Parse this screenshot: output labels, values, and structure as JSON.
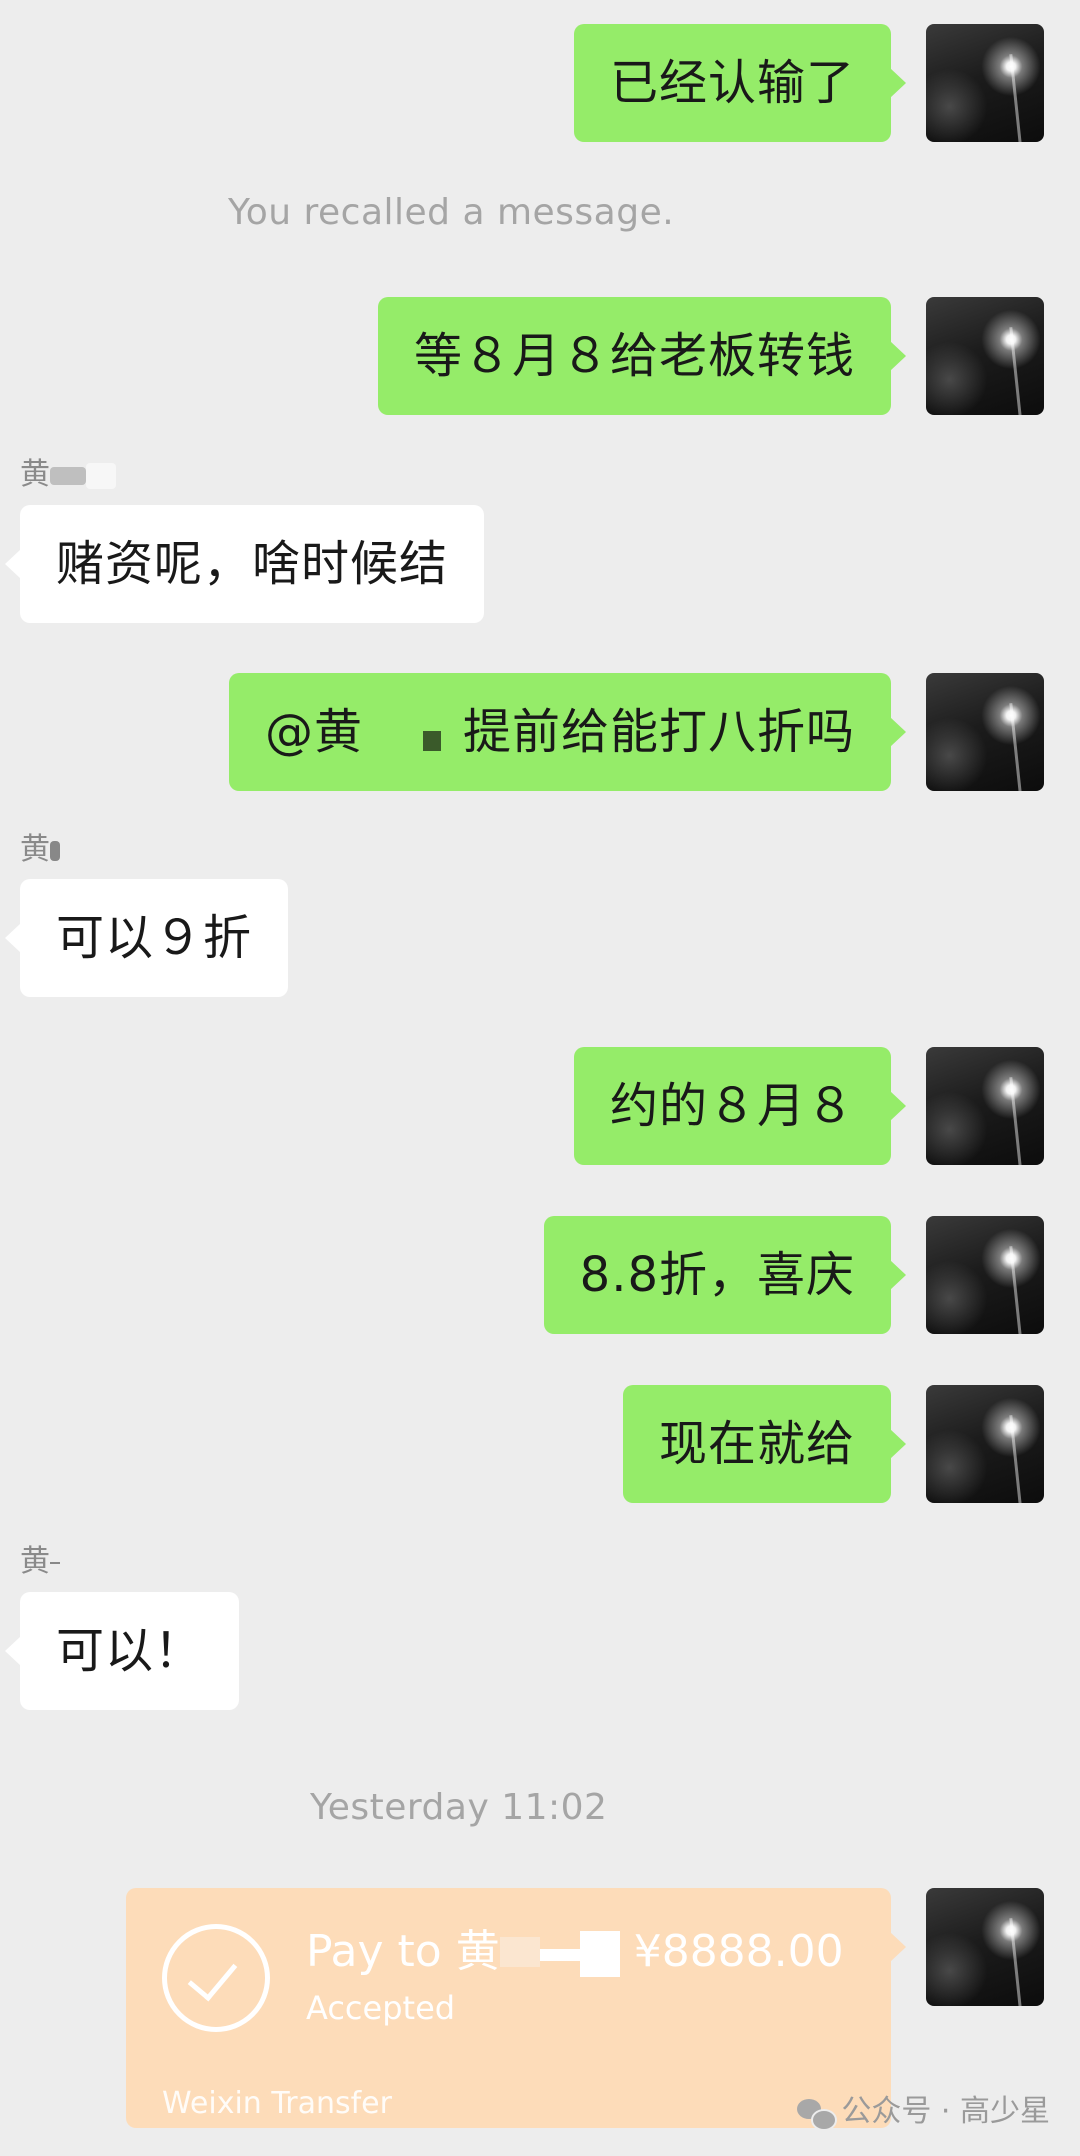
{
  "messages": {
    "m1": "已经认输了",
    "recalled": "You recalled a message.",
    "m2": "等８月８给老板转钱",
    "sender": "黄",
    "m3": "赌资呢，啥时候结",
    "m4_mention": "@黄",
    "m4_rest": "提前给能打八折吗",
    "m5": "可以９折",
    "m6": "约的８月８",
    "m7": "8.8折，喜庆",
    "m8": "现在就给",
    "m9": "可以！",
    "timestamp": "Yesterday 11:02"
  },
  "transfer": {
    "prefix": "Pay to 黄",
    "amount": "¥8888.00",
    "status": "Accepted",
    "footer": "Weixin Transfer",
    "color": "#fddcb9"
  },
  "watermark": "公众号 · 高少星",
  "colors": {
    "background": "#ededed",
    "my_bubble": "#95ec69",
    "their_bubble": "#ffffff"
  },
  "icons": {
    "avatar": "night-street-lamp-photo",
    "transfer": "check-circle-icon",
    "watermark": "wechat-icon"
  }
}
